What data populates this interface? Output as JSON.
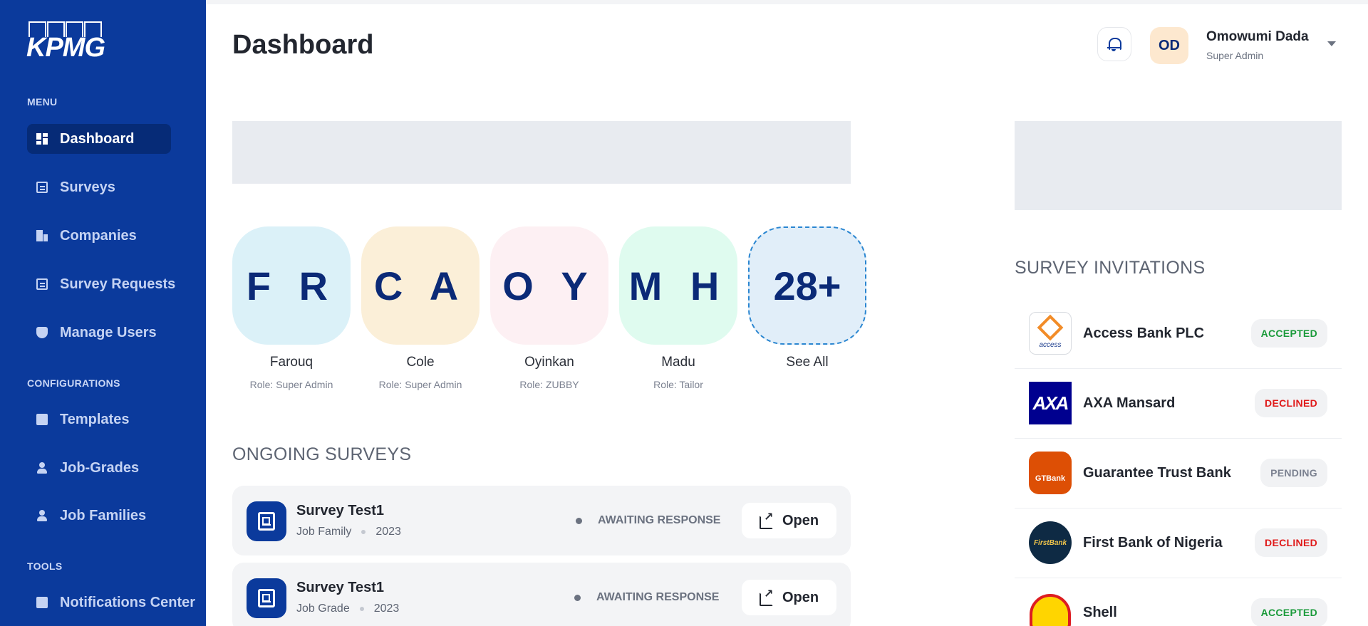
{
  "sidebar": {
    "logo": "KPMG",
    "menu_heading": "MENU",
    "config_heading": "CONFIGURATIONS",
    "tools_heading": "TOOLS",
    "items": [
      {
        "label": "Dashboard",
        "icon": "dashboard-icon"
      },
      {
        "label": "Surveys",
        "icon": "document-icon"
      },
      {
        "label": "Companies",
        "icon": "building-icon"
      },
      {
        "label": "Survey Requests",
        "icon": "request-icon"
      },
      {
        "label": "Manage Users",
        "icon": "shield-user-icon"
      },
      {
        "label": "Templates",
        "icon": "excel-icon"
      },
      {
        "label": "Job-Grades",
        "icon": "user-icon"
      },
      {
        "label": "Job Families",
        "icon": "user-icon"
      },
      {
        "label": "Notifications Center",
        "icon": "mail-check-icon"
      }
    ]
  },
  "header": {
    "title": "Dashboard",
    "user_initials": "OD",
    "user_name": "Omowumi Dada",
    "user_role": "Super Admin"
  },
  "people": [
    {
      "initials": "F R",
      "name": "Farouq",
      "role": "Role: Super Admin"
    },
    {
      "initials": "C A",
      "name": "Cole",
      "role": "Role: Super Admin"
    },
    {
      "initials": "O Y",
      "name": "Oyinkan",
      "role": "Role: ZUBBY"
    },
    {
      "initials": "M H",
      "name": "Madu",
      "role": "Role: Tailor"
    },
    {
      "initials": "28+",
      "name": "See All"
    }
  ],
  "ongoing": {
    "heading": "ONGOING SURVEYS",
    "rows": [
      {
        "title": "Survey Test1",
        "type": "Job Family",
        "year": "2023",
        "status": "AWAITING RESPONSE",
        "action": "Open"
      },
      {
        "title": "Survey Test1",
        "type": "Job Grade",
        "year": "2023",
        "status": "AWAITING RESPONSE",
        "action": "Open"
      }
    ]
  },
  "invitations": {
    "heading": "SURVEY INVITATIONS",
    "rows": [
      {
        "company": "Access Bank PLC",
        "status": "ACCEPTED",
        "logo_text": "access"
      },
      {
        "company": "AXA Mansard",
        "status": "DECLINED",
        "logo_text": "AXA"
      },
      {
        "company": "Guarantee Trust Bank",
        "status": "PENDING",
        "logo_text": "GTBank"
      },
      {
        "company": "First Bank of Nigeria",
        "status": "DECLINED",
        "logo_text": "FirstBank"
      },
      {
        "company": "Shell",
        "status": "ACCEPTED"
      }
    ]
  },
  "colors": {
    "sidebar": "#0b3a9c",
    "accepted": "#1a9a3a",
    "declined": "#e01a1a",
    "pending": "#7b8190"
  }
}
